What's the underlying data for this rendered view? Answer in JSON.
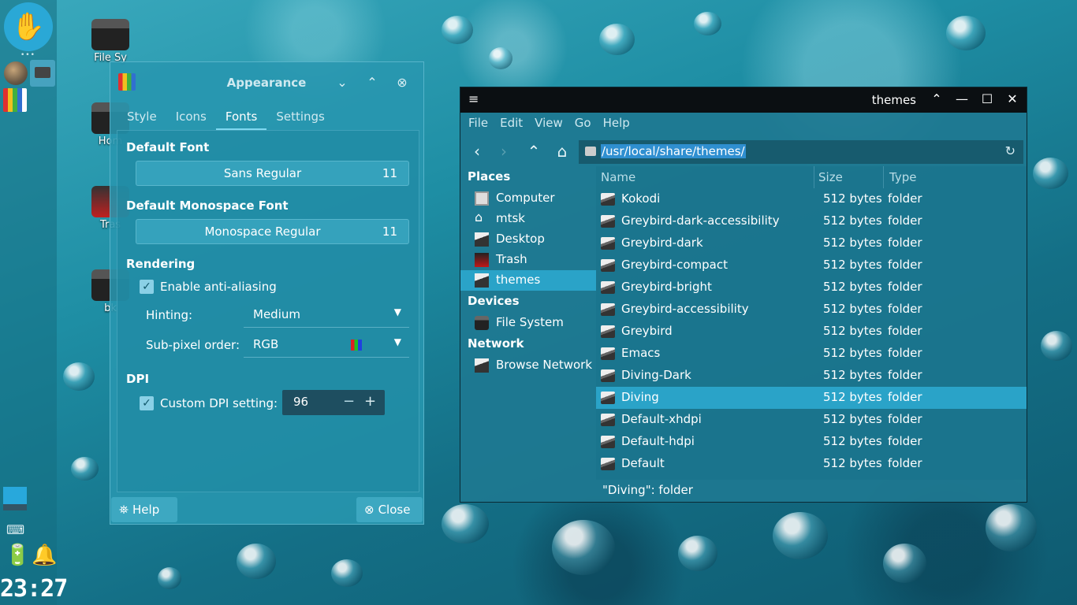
{
  "dock": {
    "clock": "23:27"
  },
  "desktop_icons": [
    {
      "label": "File Sy"
    },
    {
      "label": "Hom"
    },
    {
      "label": "Tras"
    },
    {
      "label": "bk"
    }
  ],
  "appearance": {
    "title": "Appearance",
    "tabs": [
      {
        "label": "Style"
      },
      {
        "label": "Icons"
      },
      {
        "label": "Fonts"
      },
      {
        "label": "Settings"
      }
    ],
    "active_tab": "Fonts",
    "default_font": {
      "heading": "Default Font",
      "name": "Sans Regular",
      "size": "11"
    },
    "mono_font": {
      "heading": "Default Monospace Font",
      "name": "Monospace Regular",
      "size": "11"
    },
    "rendering": {
      "heading": "Rendering",
      "antialias_label": "Enable anti-aliasing",
      "hinting_label": "Hinting:",
      "hinting_value": "Medium",
      "subpixel_label": "Sub-pixel order:",
      "subpixel_value": "RGB"
    },
    "dpi": {
      "heading": "DPI",
      "custom_label": "Custom DPI setting:",
      "value": "96"
    },
    "help_label": "Help",
    "close_label": "Close"
  },
  "filemanager": {
    "title": "themes",
    "menu": [
      {
        "label": "File"
      },
      {
        "label": "Edit"
      },
      {
        "label": "View"
      },
      {
        "label": "Go"
      },
      {
        "label": "Help"
      }
    ],
    "path": "/usr/local/share/themes/",
    "sidebar": {
      "places_heading": "Places",
      "places": [
        {
          "label": "Computer"
        },
        {
          "label": "mtsk"
        },
        {
          "label": "Desktop"
        },
        {
          "label": "Trash"
        },
        {
          "label": "themes"
        }
      ],
      "devices_heading": "Devices",
      "devices": [
        {
          "label": "File System"
        }
      ],
      "network_heading": "Network",
      "network": [
        {
          "label": "Browse Network"
        }
      ]
    },
    "columns": {
      "name": "Name",
      "size": "Size",
      "type": "Type"
    },
    "rows": [
      {
        "name": "Kokodi",
        "size": "512 bytes",
        "type": "folder"
      },
      {
        "name": "Greybird-dark-accessibility",
        "size": "512 bytes",
        "type": "folder"
      },
      {
        "name": "Greybird-dark",
        "size": "512 bytes",
        "type": "folder"
      },
      {
        "name": "Greybird-compact",
        "size": "512 bytes",
        "type": "folder"
      },
      {
        "name": "Greybird-bright",
        "size": "512 bytes",
        "type": "folder"
      },
      {
        "name": "Greybird-accessibility",
        "size": "512 bytes",
        "type": "folder"
      },
      {
        "name": "Greybird",
        "size": "512 bytes",
        "type": "folder"
      },
      {
        "name": "Emacs",
        "size": "512 bytes",
        "type": "folder"
      },
      {
        "name": "Diving-Dark",
        "size": "512 bytes",
        "type": "folder"
      },
      {
        "name": "Diving",
        "size": "512 bytes",
        "type": "folder"
      },
      {
        "name": "Default-xhdpi",
        "size": "512 bytes",
        "type": "folder"
      },
      {
        "name": "Default-hdpi",
        "size": "512 bytes",
        "type": "folder"
      },
      {
        "name": "Default",
        "size": "512 bytes",
        "type": "folder"
      }
    ],
    "selected_row": "Diving",
    "status": "\"Diving\": folder"
  }
}
